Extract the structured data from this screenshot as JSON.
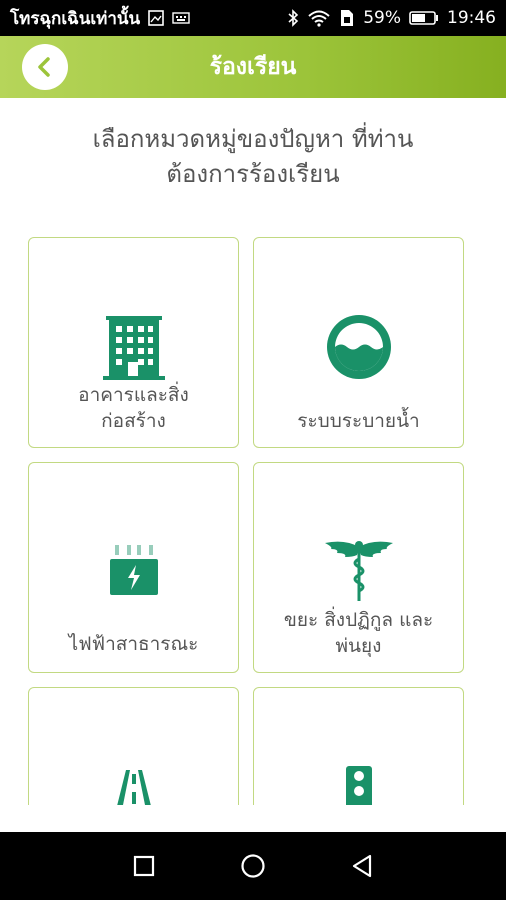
{
  "status_bar": {
    "notification": "โทรฉุกเฉินเท่านั้น",
    "battery": "59%",
    "time": "19:46"
  },
  "header": {
    "title": "ร้องเรียน"
  },
  "prompt": {
    "line1": "เลือกหมวดหมู่ของปัญหา ที่ท่าน",
    "line2": "ต้องการร้องเรียน"
  },
  "categories": [
    {
      "icon": "building-icon",
      "line1": "อาคารและสิ่ง",
      "line2": "ก่อสร้าง"
    },
    {
      "icon": "drainage-icon",
      "line1": "ระบบระบายน้ำ",
      "line2": ""
    },
    {
      "icon": "battery-icon",
      "line1": "ไฟฟ้าสาธารณะ",
      "line2": ""
    },
    {
      "icon": "caduceus-icon",
      "line1": "ขยะ สิ่งปฏิกูล และ",
      "line2": "พ่นยุง"
    },
    {
      "icon": "road-icon",
      "line1": "",
      "line2": ""
    },
    {
      "icon": "traffic-light-icon",
      "line1": "",
      "line2": ""
    }
  ],
  "colors": {
    "accent_green": "#1a9168",
    "header_green": "#9cc43a",
    "card_border": "#c2d982"
  }
}
